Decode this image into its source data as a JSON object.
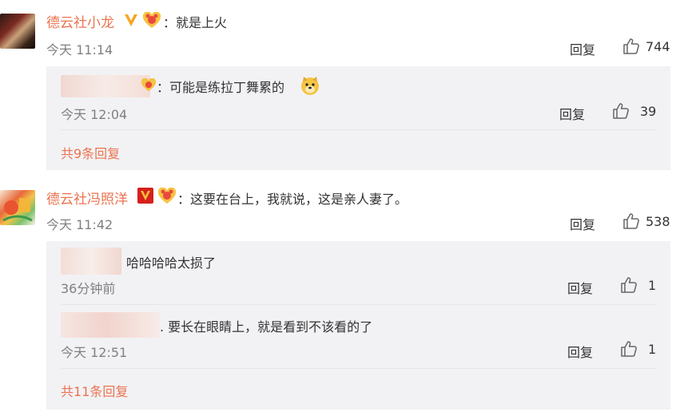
{
  "comments": [
    {
      "username": "德云社小龙",
      "text": "：就是上火",
      "time": "今天 11:14",
      "reply_label": "回复",
      "like_count": "744",
      "sub_replies": [
        {
          "text": "：可能是练拉丁舞累的",
          "time": "今天 12:04",
          "reply_label": "回复",
          "like_count": "39"
        }
      ],
      "more_replies": "共9条回复"
    },
    {
      "username": "德云社冯照洋",
      "text": "：这要在台上，我就说，这是亲人妻了。",
      "time": "今天 11:42",
      "reply_label": "回复",
      "like_count": "538",
      "sub_replies": [
        {
          "text": "哈哈哈哈太损了",
          "time": "36分钟前",
          "reply_label": "回复",
          "like_count": "1"
        },
        {
          "text": ". 要长在眼睛上，就是看到不该看的了",
          "time": "今天 12:51",
          "reply_label": "回复",
          "like_count": "1"
        }
      ],
      "more_replies": "共11条回复"
    }
  ],
  "colors": {
    "accent": "#eb7350",
    "gold": "#f5a623",
    "red_badge": "#d6201c",
    "reply_bg": "#f2f2f5"
  }
}
